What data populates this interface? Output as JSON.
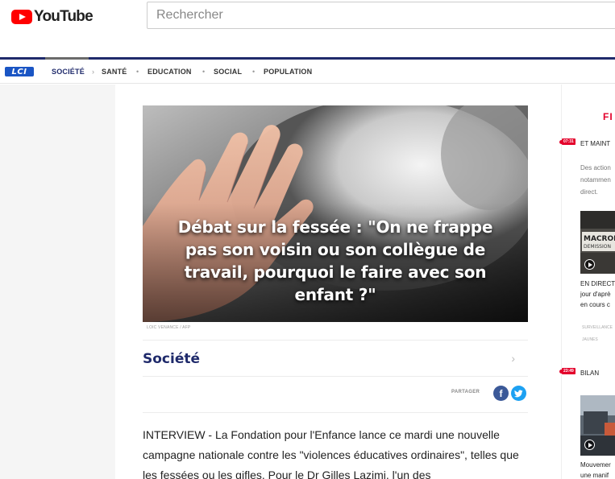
{
  "youtube": {
    "logo_text": "YouTube",
    "search_placeholder": "Rechercher"
  },
  "lci": {
    "logo_text": "LCI",
    "nav": [
      "SOCIÉTÉ",
      "SANTÉ",
      "EDUCATION",
      "SOCIAL",
      "POPULATION"
    ]
  },
  "article": {
    "hero_title": "Débat sur la fessée : \"On ne frappe pas son voisin ou son collègue de travail, pourquoi le faire avec son enfant ?\"",
    "photo_credit": "LOIC VENANCE / AFP",
    "section": "Société",
    "share_label": "PARTAGER",
    "body": "INTERVIEW - La Fondation pour l'Enfance lance ce mardi une nouvelle campagne nationale contre les \"violences éducatives ordinaires\", telles que les fessées ou les gifles. Pour le Dr Gilles Lazimi, l'un des"
  },
  "sidebar": {
    "heading": "FI",
    "items": [
      {
        "time": "07:31",
        "title": "ET MAINT",
        "excerpt": [
          "Des action",
          "notammen",
          "direct."
        ],
        "caption": [
          "EN DIRECT",
          "jour d'aprè",
          "en cours c"
        ],
        "meta": [
          "SURVEILLANCE",
          "JAUNES"
        ]
      },
      {
        "time": "23:49",
        "title": "BILAN",
        "caption": [
          "Mouvemer",
          "une manif"
        ]
      }
    ]
  },
  "colors": {
    "lci_navy": "#1f2a6b",
    "lci_red": "#e3002b",
    "youtube_red": "#ff0000",
    "facebook": "#3b5998",
    "twitter": "#1da1f2"
  }
}
